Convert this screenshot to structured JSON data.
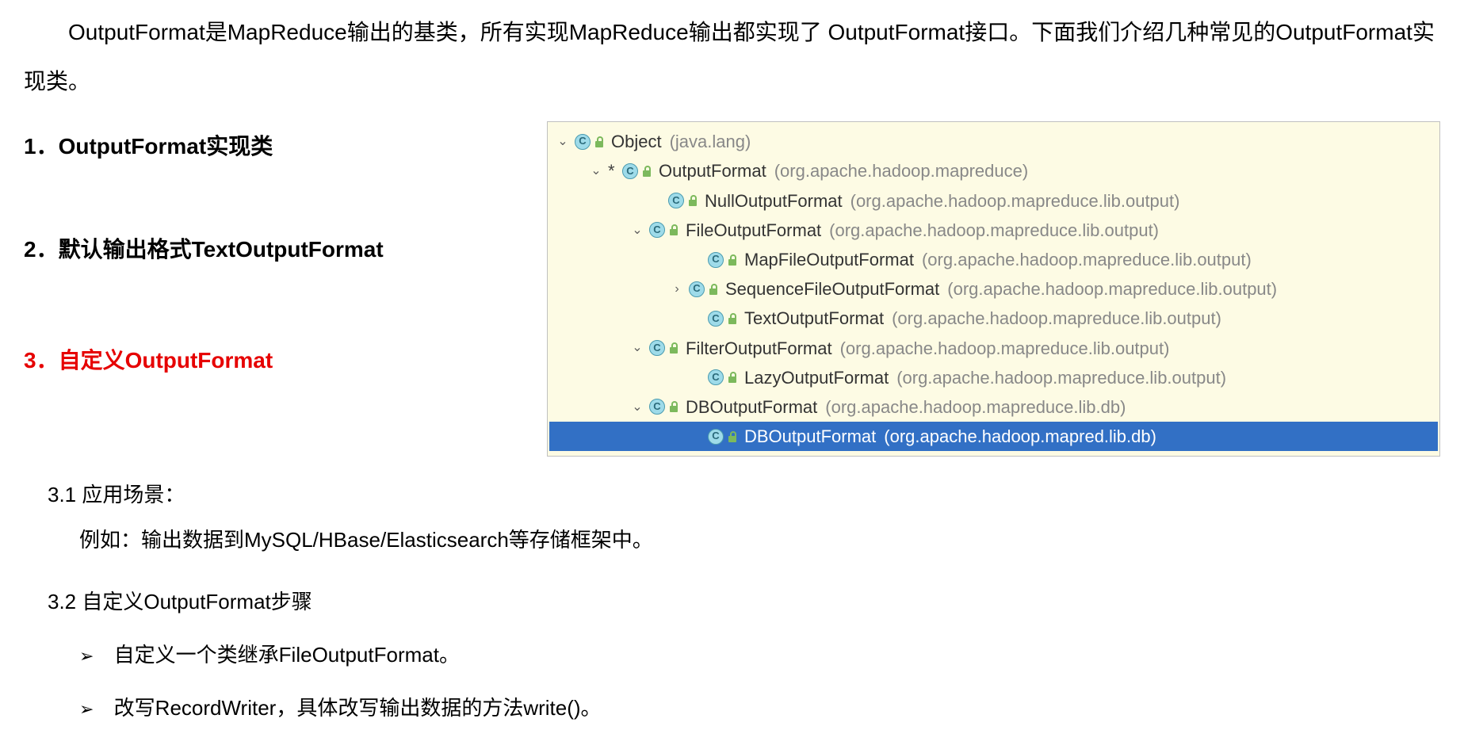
{
  "intro": "OutputFormat是MapReduce输出的基类，所有实现MapReduce输出都实现了 OutputFormat接口。下面我们介绍几种常见的OutputFormat实现类。",
  "headings": {
    "h1": "1．OutputFormat实现类",
    "h2": "2．默认输出格式TextOutputFormat",
    "h3": "3．自定义OutputFormat"
  },
  "tree": {
    "row0": {
      "arrow": "⌄",
      "name": "Object",
      "pkg": "(java.lang)"
    },
    "row1": {
      "arrow": "⌄",
      "star": "*",
      "name": "OutputFormat",
      "pkg": "(org.apache.hadoop.mapreduce)"
    },
    "row2": {
      "name": "NullOutputFormat",
      "pkg": "(org.apache.hadoop.mapreduce.lib.output)"
    },
    "row3": {
      "arrow": "⌄",
      "name": "FileOutputFormat",
      "pkg": "(org.apache.hadoop.mapreduce.lib.output)"
    },
    "row4": {
      "name": "MapFileOutputFormat",
      "pkg": "(org.apache.hadoop.mapreduce.lib.output)"
    },
    "row5": {
      "arrow": "›",
      "name": "SequenceFileOutputFormat",
      "pkg": "(org.apache.hadoop.mapreduce.lib.output)"
    },
    "row6": {
      "name": "TextOutputFormat",
      "pkg": "(org.apache.hadoop.mapreduce.lib.output)"
    },
    "row7": {
      "arrow": "⌄",
      "name": "FilterOutputFormat",
      "pkg": "(org.apache.hadoop.mapreduce.lib.output)"
    },
    "row8": {
      "name": "LazyOutputFormat",
      "pkg": "(org.apache.hadoop.mapreduce.lib.output)"
    },
    "row9": {
      "arrow": "⌄",
      "name": "DBOutputFormat",
      "pkg": "(org.apache.hadoop.mapreduce.lib.db)"
    },
    "row10": {
      "name": "DBOutputFormat",
      "pkg": "(org.apache.hadoop.mapred.lib.db)"
    }
  },
  "sections": {
    "s31": "3.1 应用场景：",
    "s31_text": "例如：输出数据到MySQL/HBase/Elasticsearch等存储框架中。",
    "s32": "3.2 自定义OutputFormat步骤",
    "bullet1": "自定义一个类继承FileOutputFormat。",
    "bullet2": "改写RecordWriter，具体改写输出数据的方法write()。",
    "bullet_arrow": "➢"
  },
  "icons": {
    "class_letter": "C"
  }
}
